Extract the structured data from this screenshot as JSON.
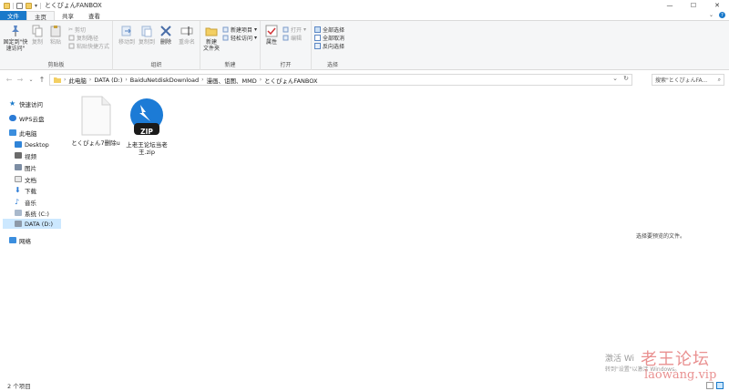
{
  "window": {
    "title": "とくぴょんFANBOX"
  },
  "tabs": {
    "file": "文件",
    "home": "主页",
    "share": "共享",
    "view": "查看"
  },
  "ribbon": {
    "clipboard": {
      "label": "剪贴板",
      "pin": "固定到\"快速访问\"",
      "copy": "复制",
      "paste": "粘贴",
      "cut": "剪切",
      "copy_path": "复制路径",
      "paste_shortcut": "粘贴快捷方式"
    },
    "organize": {
      "label": "组织",
      "move_to": "移动到",
      "copy_to": "复制到",
      "delete": "删除",
      "rename": "重命名"
    },
    "new": {
      "label": "新建",
      "new_folder": "新建\n文件夹",
      "new_item": "新建项目",
      "easy_access": "轻松访问"
    },
    "open": {
      "label": "打开",
      "properties": "属性",
      "open": "打开",
      "edit": "编辑"
    },
    "select": {
      "label": "选择",
      "select_all": "全部选择",
      "select_none": "全部取消",
      "invert": "反向选择"
    }
  },
  "address": {
    "crumbs": [
      "此电脑",
      "DATA (D:)",
      "BaiduNetdiskDownload",
      "漫画、诅图、MMD",
      "とくぴょんFANBOX"
    ],
    "search_placeholder": "搜索\"とくぴょんFA..."
  },
  "nav": {
    "quick_access": "快速访问",
    "wps": "WPS云盘",
    "this_pc": "此电脑",
    "desktop": "Desktop",
    "videos": "视频",
    "pictures": "图片",
    "documents": "文档",
    "downloads": "下载",
    "music": "音乐",
    "system_c": "系统 (C:)",
    "data_d": "DATA (D:)",
    "network": "网络"
  },
  "files": [
    {
      "name": "とくぴょん7删除u",
      "type": "blank"
    },
    {
      "name": "上老王论坛当老王.zip",
      "type": "zip",
      "badge": "ZIP"
    }
  ],
  "preview_hint": "选择要预览的文件。",
  "status": {
    "count": "2 个项目"
  },
  "watermark": {
    "activate_1": "激活 Wi",
    "activate_2": "转到\"设置\"以激活 Windows。",
    "site_1": "老王论坛",
    "site_2": "laowang.vip"
  }
}
